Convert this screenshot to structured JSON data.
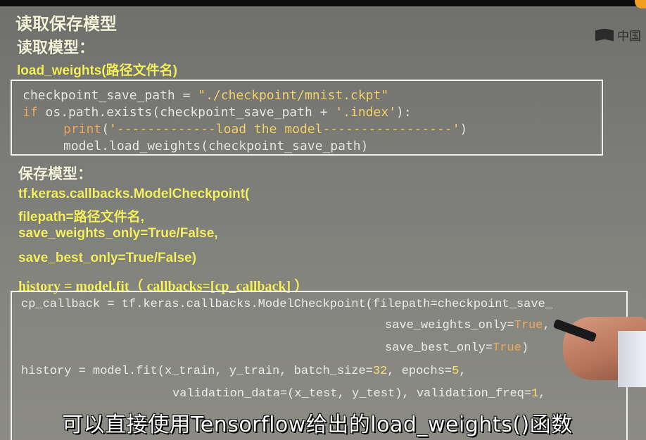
{
  "slide": {
    "title": "读取保存模型",
    "load_heading": "读取模型：",
    "load_fn": "load_weights(路径文件名)",
    "save_heading": "保存模型：",
    "save_lines": [
      "tf.keras.callbacks.ModelCheckpoint(",
      "filepath=路径文件名,",
      "save_weights_only=True/False,",
      "save_best_only=True/False)"
    ],
    "history_line": "history = model.fit（ callbacks=[cp_callback] ）"
  },
  "logo": {
    "text": "中国"
  },
  "code_box1": {
    "line1_a": "checkpoint_save_path = ",
    "line1_b": "\"./checkpoint/mnist.ckpt\"",
    "line2_kw": "if",
    "line2_a": " os.path.exists(checkpoint_save_path + ",
    "line2_b": "'.index'",
    "line2_c": "):",
    "line3_kw": "print",
    "line3_a": "(",
    "line3_b": "'-------------load the model-----------------'",
    "line3_c": ")",
    "line4": "model.load_weights(checkpoint_save_path)"
  },
  "code_box2": {
    "line1": "cp_callback = tf.keras.callbacks.ModelCheckpoint(filepath=checkpoint_save_",
    "line2_a": "save_weights_only=",
    "line2_b": "True",
    "line2_c": ",",
    "line3_a": "save_best_only=",
    "line3_b": "True",
    "line3_c": ")",
    "line4_a": "history = model.fit(x_train, y_train, batch_size=",
    "line4_b": "32",
    "line4_c": ", epochs=",
    "line4_d": "5",
    "line4_e": ",",
    "line5_a": "validation_data=(x_test, y_test), validation_freq=",
    "line5_b": "1",
    "line5_c": ","
  },
  "subtitle": "可以直接使用Tensorflow给出的load_weights()函数"
}
